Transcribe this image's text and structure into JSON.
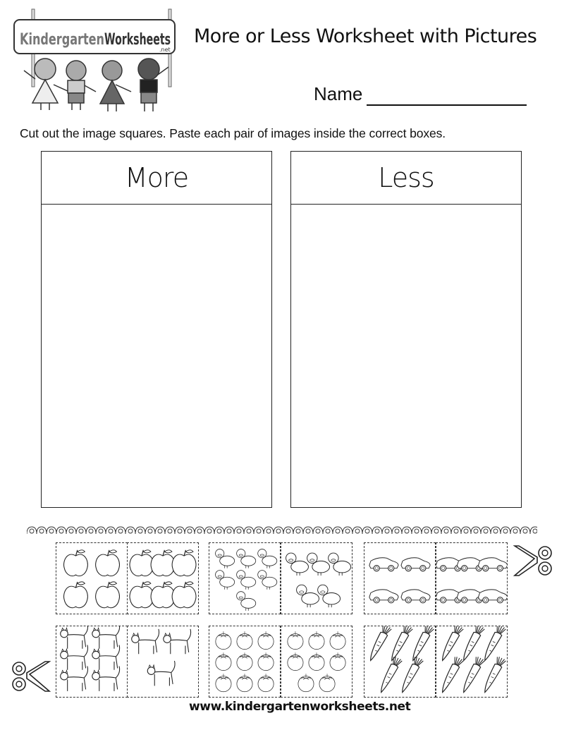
{
  "logo": {
    "brand_first": "Kindergarten",
    "brand_second": "Worksheets",
    "brand_suffix": ".net"
  },
  "header": {
    "title": "More or Less Worksheet with Pictures",
    "name_label": "Name"
  },
  "instructions": "Cut out the image squares. Paste each pair of images inside the correct boxes.",
  "panels": [
    {
      "label": "More"
    },
    {
      "label": "Less"
    }
  ],
  "cutouts": {
    "row1": [
      {
        "item": "apple",
        "counts": [
          4,
          6
        ]
      },
      {
        "item": "duck",
        "counts": [
          7,
          5
        ]
      },
      {
        "item": "car",
        "counts": [
          4,
          6
        ]
      }
    ],
    "row2": [
      {
        "item": "cat",
        "counts": [
          6,
          3
        ]
      },
      {
        "item": "tomato",
        "counts": [
          9,
          8
        ]
      },
      {
        "item": "carrot",
        "counts": [
          5,
          6
        ]
      }
    ]
  },
  "icons": {
    "scissors_right": "scissors-icon",
    "scissors_left": "scissors-icon"
  },
  "footer": "www.kindergartenworksheets.net"
}
